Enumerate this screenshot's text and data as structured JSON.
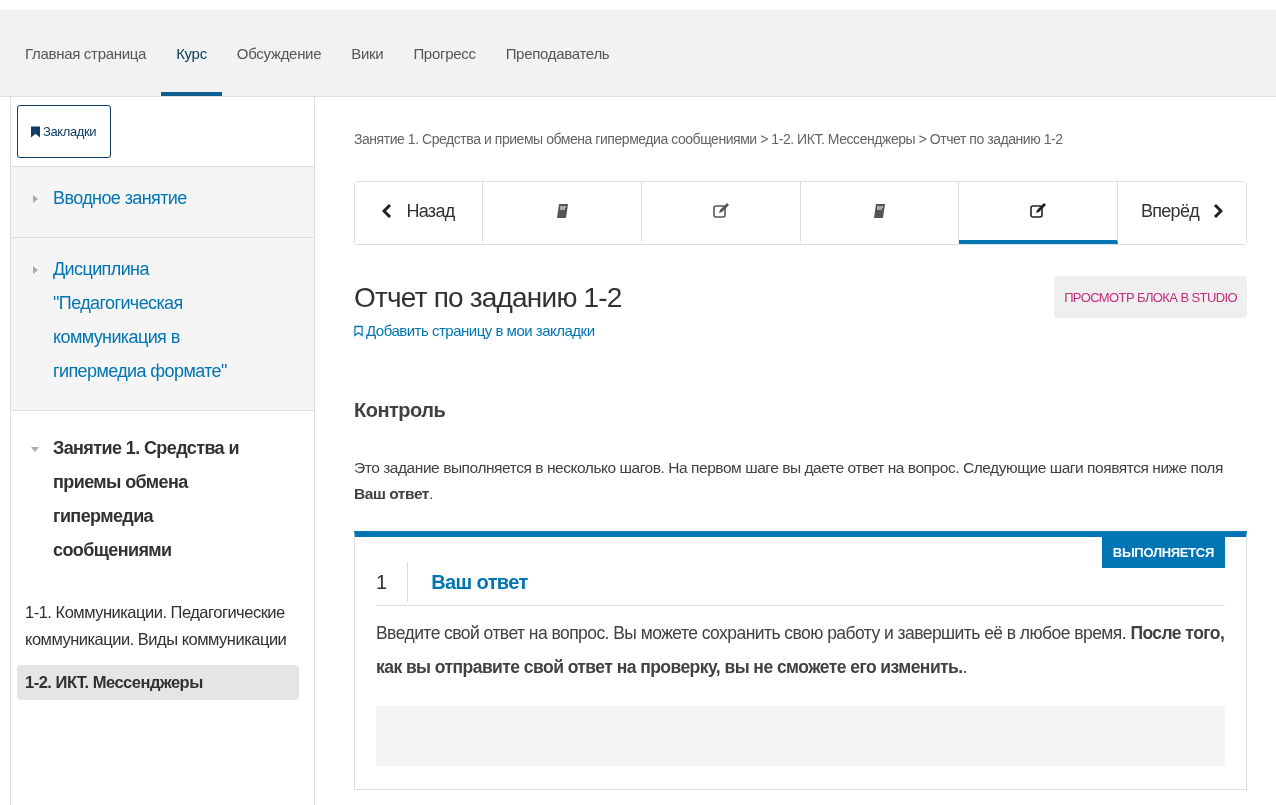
{
  "nav_tabs": [
    {
      "label": "Главная страница",
      "selected": false
    },
    {
      "label": "Курс",
      "selected": true
    },
    {
      "label": "Обсуждение",
      "selected": false
    },
    {
      "label": "Вики",
      "selected": false
    },
    {
      "label": "Прогресс",
      "selected": false
    },
    {
      "label": "Преподаватель",
      "selected": false
    }
  ],
  "sidebar": {
    "bookmarks_button": "Закладки",
    "sections": [
      {
        "title": "Вводное занятие",
        "expanded": false
      },
      {
        "title": "Дисциплина \"Педагогическая коммуникация в гипермедиа формате\"",
        "expanded": false
      },
      {
        "title": "Занятие 1. Средства и приемы обмена гипермедиа сообщениями",
        "expanded": true,
        "children": [
          {
            "title": "1-1. Коммуникации. Педагогические коммуникации. Виды коммуникации",
            "selected": false
          },
          {
            "title": "1-2. ИКТ. Мессенджеры",
            "selected": true
          }
        ]
      }
    ]
  },
  "breadcrumb": "Занятие 1. Средства и приемы обмена гипермедиа сообщениями > 1-2. ИКТ. Мессенджеры > Отчет по заданию 1-2",
  "sequence": [
    {
      "kind": "prev",
      "label": "Назад",
      "selected": false
    },
    {
      "kind": "book",
      "selected": false
    },
    {
      "kind": "edit",
      "selected": false
    },
    {
      "kind": "book",
      "selected": false
    },
    {
      "kind": "edit",
      "selected": true
    },
    {
      "kind": "next",
      "label": "Вперёд",
      "selected": false
    }
  ],
  "page_title": "Отчет по заданию 1-2",
  "studio_button": "ПРОСМОТР БЛОКА В STUDIO",
  "bookmark_link": "Добавить страницу в мои закладки",
  "section_heading": "Контроль",
  "intro": "Это задание выполняется в несколько шагов. На первом шаге вы даете ответ на вопрос. Следующие шаги появятся ниже поля **Ваш ответ**.",
  "step": {
    "number": "1",
    "title": "Ваш ответ",
    "status": "ВЫПОЛНЯЕТСЯ",
    "text": "Введите свой ответ на вопрос. Вы можете сохранить свою работу и завершить её в любое время. **После того, как вы отправите свой ответ на проверку, вы не сможете его изменить.**."
  }
}
